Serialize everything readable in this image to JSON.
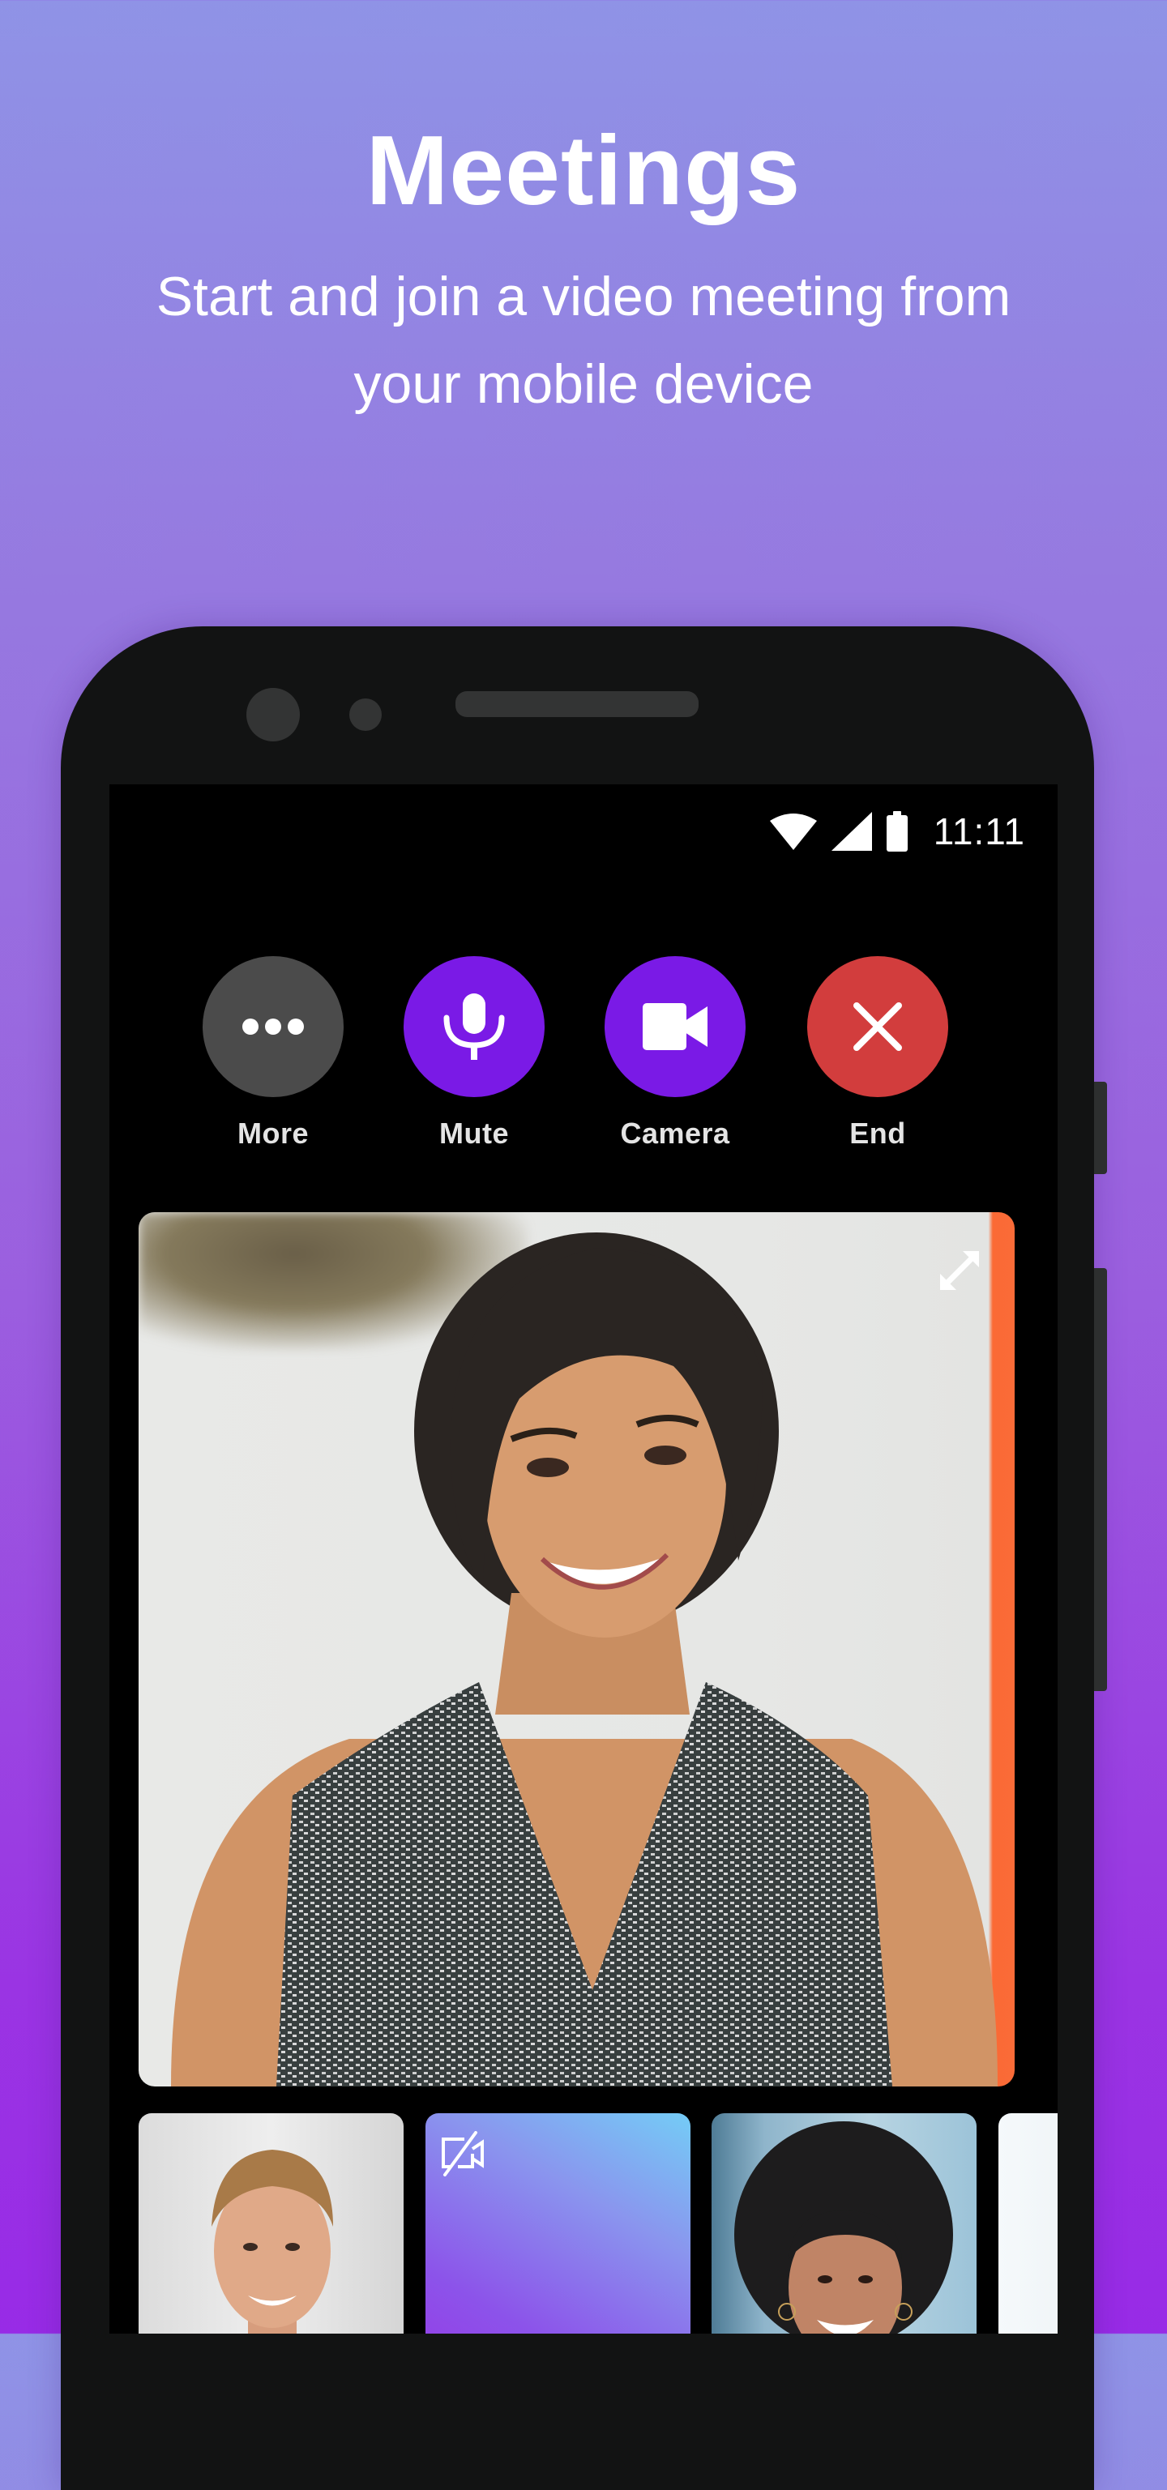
{
  "promo": {
    "title": "Meetings",
    "subtitle_line1": "Start and join a video meeting from",
    "subtitle_line2": "your mobile device"
  },
  "status_bar": {
    "time": "11:11",
    "icons": [
      "wifi-icon",
      "cellular-signal-icon",
      "battery-icon"
    ]
  },
  "call_controls": [
    {
      "id": "more",
      "label": "More",
      "icon": "more-dots-icon",
      "color": "#4b4b4b"
    },
    {
      "id": "mute",
      "label": "Mute",
      "icon": "microphone-icon",
      "color": "#7a1ae6"
    },
    {
      "id": "camera",
      "label": "Camera",
      "icon": "video-camera-icon",
      "color": "#7a1ae6"
    },
    {
      "id": "end",
      "label": "End",
      "icon": "close-icon",
      "color": "#d23d3d"
    }
  ],
  "main_video": {
    "participant": "speaker-woman",
    "action_icon": "expand-icon"
  },
  "thumbnails": [
    {
      "participant": "man",
      "video": "on"
    },
    {
      "participant": "camera-off",
      "video": "off",
      "icon": "camera-off-icon"
    },
    {
      "participant": "woman",
      "video": "on"
    },
    {
      "participant": "partial",
      "video": "on"
    }
  ],
  "colors": {
    "accent_purple": "#7a1ae6",
    "end_red": "#d23d3d",
    "more_gray": "#4b4b4b",
    "phone_body": "#121313"
  }
}
